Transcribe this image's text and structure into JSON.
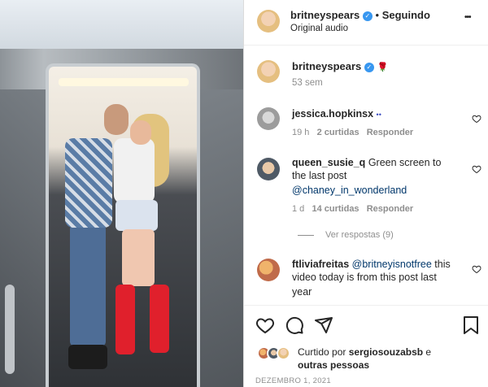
{
  "post": {
    "username": "britneyspears",
    "follow_status": "Seguindo",
    "separator": "•",
    "audio": "Original audio",
    "more": "•••"
  },
  "caption": {
    "username": "britneyspears",
    "emoji": "🌹",
    "age": "53 sem"
  },
  "comments": [
    {
      "username": "jessica.hopkinsx",
      "text": "••",
      "age": "19 h",
      "likes": "2 curtidas",
      "reply": "Responder"
    },
    {
      "username": "queen_susie_q",
      "text_line1": "Green screen to",
      "text_line2": "the last post",
      "mention": "@chaney_in_wonderland",
      "age": "1 d",
      "likes": "14 curtidas",
      "reply": "Responder",
      "view_replies": "Ver respostas (9)"
    },
    {
      "username": "ftliviafreitas",
      "mention": "@britneyisnotfree",
      "text_line1": "this",
      "text_line2": "video today is from this post last",
      "text_line3": "year"
    }
  ],
  "likes_summary": {
    "prefix": "Curtido por",
    "user": "sergiosouzabsb",
    "middle": "e",
    "others": "outras pessoas"
  },
  "date": "DEZEMBRO 1, 2021",
  "colors": {
    "verified": "#3897f0",
    "link": "#00376b",
    "muted": "#8e8e8e",
    "text": "#262626"
  }
}
